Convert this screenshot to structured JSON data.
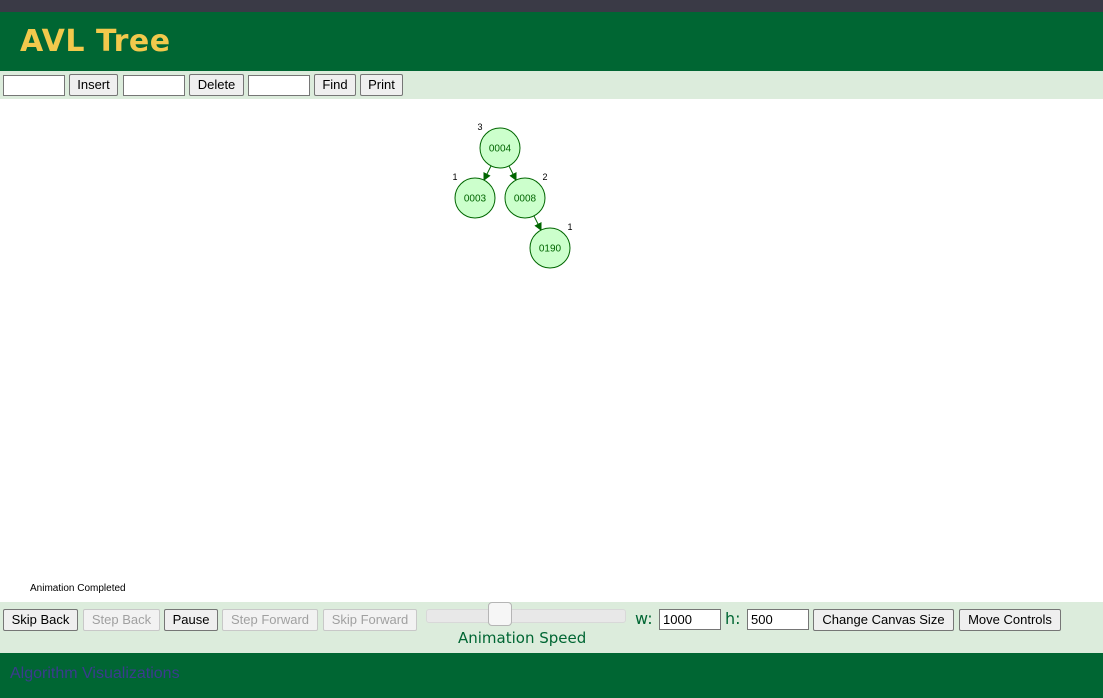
{
  "header": {
    "title": "AVL Tree"
  },
  "toolbar": {
    "insert": {
      "value": "",
      "label": "Insert"
    },
    "delete": {
      "value": "",
      "label": "Delete"
    },
    "find": {
      "value": "",
      "label": "Find"
    },
    "print_label": "Print"
  },
  "tree": {
    "node_fill": "#ccffcc",
    "node_stroke": "#006600",
    "edge_color": "#006600",
    "nodes": [
      {
        "id": "n4",
        "label": "0004",
        "height": "3",
        "parent": null
      },
      {
        "id": "n3",
        "label": "0003",
        "height": "1",
        "parent": "n4",
        "side": "left"
      },
      {
        "id": "n8",
        "label": "0008",
        "height": "2",
        "parent": "n4",
        "side": "right"
      },
      {
        "id": "n190",
        "label": "0190",
        "height": "1",
        "parent": "n8",
        "side": "right"
      }
    ]
  },
  "status_text": "Animation Completed",
  "controls": {
    "skip_back": "Skip Back",
    "step_back": "Step Back",
    "pause": "Pause",
    "step_forward": "Step Forward",
    "skip_forward": "Skip Forward",
    "speed_label": "Animation Speed",
    "speed_fraction": 0.37,
    "width_label": "w:",
    "width_value": "1000",
    "height_label": "h:",
    "height_value": "500",
    "change_size": "Change Canvas Size",
    "move_controls": "Move Controls"
  },
  "footer": {
    "link_text": "Algorithm Visualizations"
  },
  "colors": {
    "header_bg": "#006633",
    "title": "#f2c94c",
    "bar_bg": "#dcecdc",
    "accent_text": "#006633"
  }
}
